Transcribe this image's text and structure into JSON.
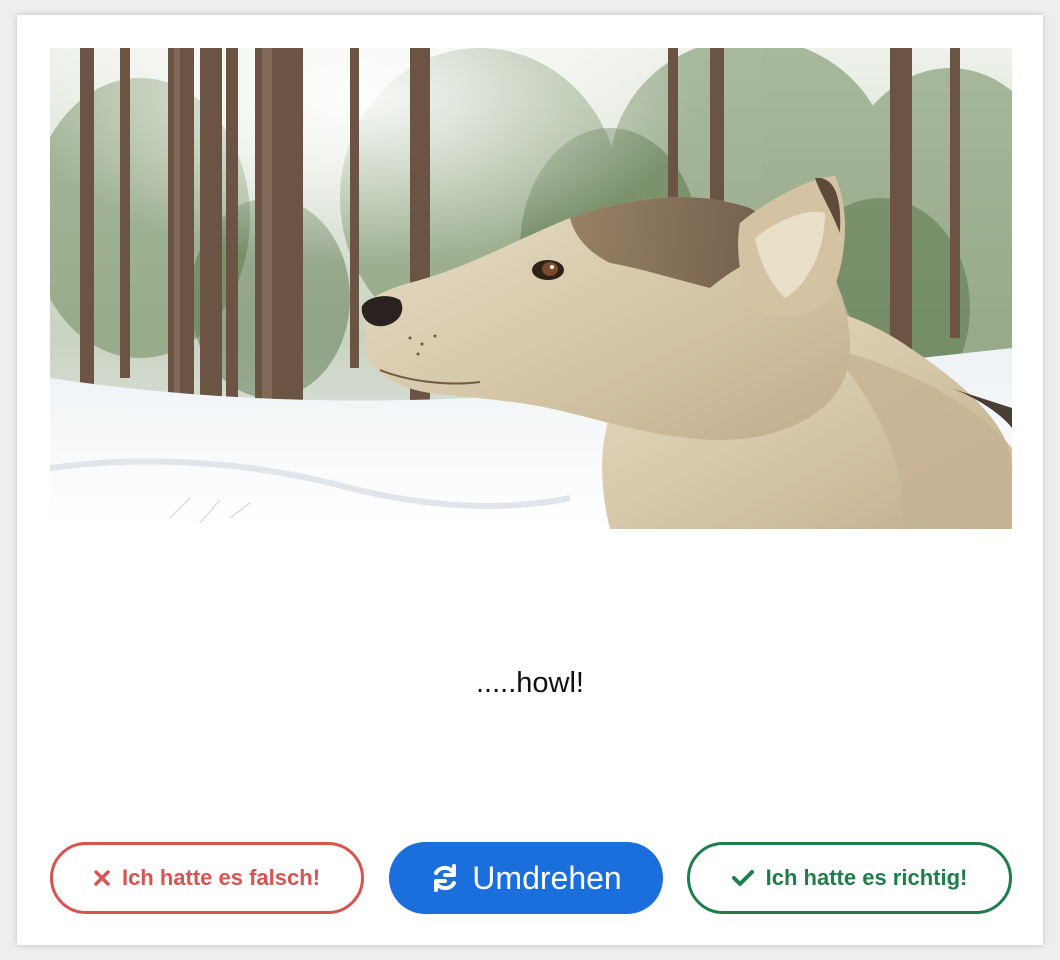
{
  "card": {
    "image": {
      "subject": "husky-dog-in-snowy-forest"
    },
    "answer_text": ".....howl!"
  },
  "buttons": {
    "wrong": {
      "label": "Ich hatte es falsch!",
      "icon": "x-icon",
      "color": "#d9534f"
    },
    "flip": {
      "label": "Umdrehen",
      "icon": "refresh-icon",
      "color": "#1a6fdc"
    },
    "right": {
      "label": "Ich hatte es richtig!",
      "icon": "check-icon",
      "color": "#1e7e4a"
    }
  }
}
